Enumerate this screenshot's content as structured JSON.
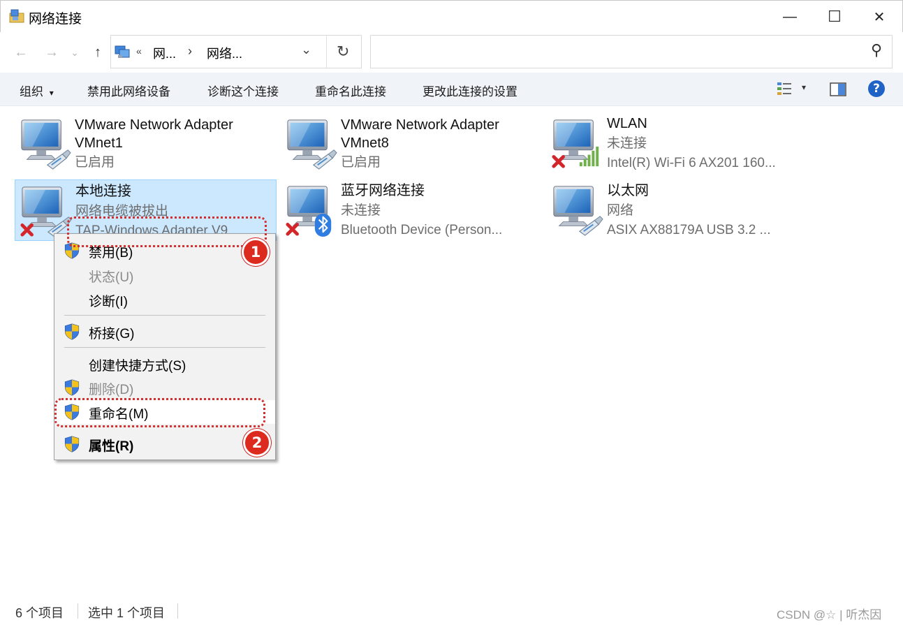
{
  "window": {
    "title": "网络连接",
    "minimize_glyph": "—",
    "maximize_glyph": "☐",
    "close_glyph": "✕"
  },
  "nav": {
    "back_glyph": "←",
    "forward_glyph": "→",
    "recent_glyph": "⌄",
    "up_glyph": "↑",
    "breadcrumb_overflow": "«",
    "breadcrumb": [
      "网...",
      "网络..."
    ],
    "breadcrumb_sep": "›",
    "dropdown_glyph": "⌄",
    "refresh_glyph": "↻",
    "search_placeholder": "",
    "search_glyph": "⚲"
  },
  "commands": {
    "organize": "组织",
    "organize_arrow": "▾",
    "disable": "禁用此网络设备",
    "diagnose": "诊断这个连接",
    "rename": "重命名此连接",
    "change_settings": "更改此连接的设置",
    "view_arrow": "▾",
    "help_glyph": "?"
  },
  "items": [
    {
      "name1": "VMware Network Adapter",
      "name2": "VMnet1",
      "status": "已启用",
      "device": "",
      "icon": "network-adapter-icon",
      "selected": false
    },
    {
      "name1": "VMware Network Adapter",
      "name2": "VMnet8",
      "status": "已启用",
      "device": "",
      "icon": "network-adapter-icon",
      "selected": false
    },
    {
      "name1": "WLAN",
      "name2": "",
      "status": "未连接",
      "device": "Intel(R) Wi-Fi 6 AX201 160...",
      "icon": "wifi-disconnected-icon",
      "selected": false
    },
    {
      "name1": "本地连接",
      "name2": "",
      "status": "网络电缆被拔出",
      "device": "TAP-Windows Adapter V9",
      "icon": "network-adapter-disconnected-icon",
      "selected": true
    },
    {
      "name1": "蓝牙网络连接",
      "name2": "",
      "status": "未连接",
      "device": "Bluetooth Device (Person...",
      "icon": "bluetooth-disconnected-icon",
      "selected": false
    },
    {
      "name1": "以太网",
      "name2": "",
      "status": "网络",
      "device": "ASIX AX88179A USB 3.2 ...",
      "icon": "ethernet-icon",
      "selected": false
    }
  ],
  "context_menu": {
    "disable": "禁用(B)",
    "status": "状态(U)",
    "diagnose": "诊断(I)",
    "bridge": "桥接(G)",
    "shortcut": "创建快捷方式(S)",
    "delete": "删除(D)",
    "rename": "重命名(M)",
    "properties": "属性(R)"
  },
  "annotations": {
    "badge1": "1",
    "badge2": "2",
    "color": "#dd2a1f"
  },
  "status": {
    "count": "6 个项目",
    "selected": "选中 1 个项目"
  },
  "watermark": "CSDN @☆ | 听杰因",
  "colors": {
    "selection_bg": "#cce8ff",
    "selection_border": "#99d1ff",
    "command_bar_bg": "#f0f4f9",
    "help_blue": "#1f63c6"
  }
}
